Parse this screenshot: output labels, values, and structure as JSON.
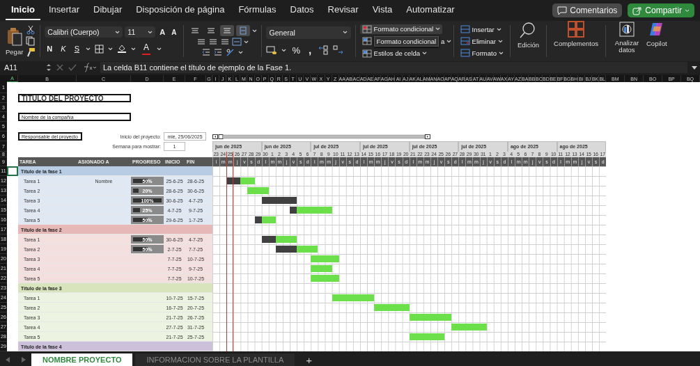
{
  "tabs": [
    {
      "label": "Inicio",
      "selected": true
    },
    {
      "label": "Insertar",
      "selected": false
    },
    {
      "label": "Dibujar",
      "selected": false
    },
    {
      "label": "Disposición de página",
      "selected": false
    },
    {
      "label": "Fórmulas",
      "selected": false
    },
    {
      "label": "Datos",
      "selected": false
    },
    {
      "label": "Revisar",
      "selected": false
    },
    {
      "label": "Vista",
      "selected": false
    },
    {
      "label": "Automatizar",
      "selected": false
    }
  ],
  "comments_button": "Comentarios",
  "share_button": "Compartir",
  "ribbon": {
    "paste": "Pegar",
    "font_family": "Calibri (Cuerpo)",
    "font_size": "11",
    "grow": "A",
    "shrink": "A",
    "bold": "N",
    "italic": "K",
    "underline": "S",
    "font_color": "A",
    "align_buttons": [
      {
        "on": false
      },
      {
        "on": false
      },
      {
        "on": true
      },
      {
        "on": true
      }
    ],
    "number_format": "General",
    "percent": "%",
    "comma": ",",
    "styles": [
      {
        "label": "Formato condicional",
        "highlighted": true
      },
      {
        "label": "a",
        "tooltip": "Formato condicional",
        "highlighted": false
      },
      {
        "label": "Estilos de celda",
        "highlighted": false
      }
    ],
    "cells": [
      "Insertar",
      "Eliminar",
      "Formato"
    ],
    "editing": "Edición",
    "addins": "Complementos",
    "analyze": "Analizar datos",
    "copilot": "Copilot"
  },
  "formula_bar": {
    "name_box": "A11",
    "formula": "La celda B11 contiene el título de ejemplo de la Fase 1."
  },
  "sheet": {
    "columns": [
      "A",
      "B",
      "C",
      "D",
      "E",
      "F",
      "G",
      "I",
      "J",
      "K",
      "L",
      "M",
      "N",
      "O",
      "P",
      "Q",
      "R",
      "S",
      "T",
      "U",
      "V",
      "W",
      "X",
      "Y",
      "Z",
      "AA",
      "AB",
      "AC",
      "AD",
      "AE",
      "AF",
      "AG",
      "AH",
      "AI",
      "AJ",
      "AK",
      "AL",
      "AM",
      "AN",
      "AO",
      "AP",
      "AQ",
      "AR",
      "AS",
      "AT",
      "AU",
      "AV",
      "AW",
      "AX",
      "AY",
      "AZ",
      "BA",
      "BB",
      "BC",
      "BD",
      "BE",
      "BF",
      "BG",
      "BH",
      "BI",
      "BJ",
      "BK",
      "BL",
      "BM",
      "BN",
      "BO",
      "BP",
      "BQ"
    ],
    "rows": [
      "1",
      "2",
      "3",
      "4",
      "5",
      "6",
      "7",
      "8",
      "9",
      "11",
      "12",
      "13",
      "14",
      "15",
      "16",
      "17",
      "18",
      "19",
      "20",
      "21",
      "22",
      "23",
      "24",
      "25",
      "26",
      "27",
      "28",
      "29"
    ],
    "title": "TÍTULO DEL PROYECTO",
    "company": "Nombre de la compañía",
    "manager": "Responsable del proyecto",
    "start_label": "Inicio del proyecto:",
    "start_value": "mié, 25/06/2025",
    "week_label": "Semana para mostrar:",
    "week_value": "1",
    "headers": [
      "TAREA",
      "ASIGNADO A",
      "PROGRESO",
      "INICIO",
      "FIN"
    ],
    "weeks": [
      {
        "label": "jun de 2025",
        "days": [
          {
            "num": "23",
            "weekday": "l",
            "today": false
          },
          {
            "num": "24",
            "weekday": "m",
            "today": false
          },
          {
            "num": "25",
            "weekday": "m",
            "today": true
          },
          {
            "num": "26",
            "weekday": "j",
            "today": false
          },
          {
            "num": "27",
            "weekday": "v",
            "today": false
          },
          {
            "num": "28",
            "weekday": "s",
            "today": false
          },
          {
            "num": "29",
            "weekday": "d",
            "today": false
          }
        ]
      },
      {
        "label": "jun de 2025",
        "days": [
          {
            "num": "30",
            "weekday": "l",
            "today": false
          },
          {
            "num": "1",
            "weekday": "m",
            "today": false
          },
          {
            "num": "2",
            "weekday": "m",
            "today": false
          },
          {
            "num": "3",
            "weekday": "j",
            "today": false
          },
          {
            "num": "4",
            "weekday": "v",
            "today": false
          },
          {
            "num": "5",
            "weekday": "s",
            "today": false
          },
          {
            "num": "6",
            "weekday": "d",
            "today": false
          }
        ]
      },
      {
        "label": "jul de 2025",
        "days": [
          {
            "num": "7",
            "weekday": "l",
            "today": false
          },
          {
            "num": "8",
            "weekday": "m",
            "today": false
          },
          {
            "num": "9",
            "weekday": "m",
            "today": false
          },
          {
            "num": "10",
            "weekday": "j",
            "today": false
          },
          {
            "num": "11",
            "weekday": "v",
            "today": false
          },
          {
            "num": "12",
            "weekday": "s",
            "today": false
          },
          {
            "num": "13",
            "weekday": "d",
            "today": false
          }
        ]
      },
      {
        "label": "jul de 2025",
        "days": [
          {
            "num": "14",
            "weekday": "l",
            "today": false
          },
          {
            "num": "15",
            "weekday": "m",
            "today": false
          },
          {
            "num": "16",
            "weekday": "m",
            "today": false
          },
          {
            "num": "17",
            "weekday": "j",
            "today": false
          },
          {
            "num": "18",
            "weekday": "v",
            "today": false
          },
          {
            "num": "19",
            "weekday": "s",
            "today": false
          },
          {
            "num": "20",
            "weekday": "d",
            "today": false
          }
        ]
      },
      {
        "label": "jul de 2025",
        "days": [
          {
            "num": "21",
            "weekday": "l",
            "today": false
          },
          {
            "num": "22",
            "weekday": "m",
            "today": false
          },
          {
            "num": "23",
            "weekday": "m",
            "today": false
          },
          {
            "num": "24",
            "weekday": "j",
            "today": false
          },
          {
            "num": "25",
            "weekday": "v",
            "today": false
          },
          {
            "num": "26",
            "weekday": "s",
            "today": false
          },
          {
            "num": "27",
            "weekday": "d",
            "today": false
          }
        ]
      },
      {
        "label": "jul de 2025",
        "days": [
          {
            "num": "28",
            "weekday": "l",
            "today": false
          },
          {
            "num": "29",
            "weekday": "m",
            "today": false
          },
          {
            "num": "30",
            "weekday": "m",
            "today": false
          },
          {
            "num": "31",
            "weekday": "j",
            "today": false
          },
          {
            "num": "1",
            "weekday": "v",
            "today": false
          },
          {
            "num": "2",
            "weekday": "s",
            "today": false
          },
          {
            "num": "3",
            "weekday": "d",
            "today": false
          }
        ]
      },
      {
        "label": "ago de 2025",
        "days": [
          {
            "num": "4",
            "weekday": "l",
            "today": false
          },
          {
            "num": "5",
            "weekday": "m",
            "today": false
          },
          {
            "num": "6",
            "weekday": "m",
            "today": false
          },
          {
            "num": "7",
            "weekday": "j",
            "today": false
          },
          {
            "num": "8",
            "weekday": "v",
            "today": false
          },
          {
            "num": "9",
            "weekday": "s",
            "today": false
          },
          {
            "num": "10",
            "weekday": "d",
            "today": false
          }
        ]
      },
      {
        "label": "ago de 2025",
        "days": [
          {
            "num": "11",
            "weekday": "l",
            "today": false
          },
          {
            "num": "12",
            "weekday": "m",
            "today": false
          },
          {
            "num": "13",
            "weekday": "m",
            "today": false
          },
          {
            "num": "14",
            "weekday": "j",
            "today": false
          },
          {
            "num": "15",
            "weekday": "v",
            "today": false
          },
          {
            "num": "16",
            "weekday": "s",
            "today": false
          },
          {
            "num": "17",
            "weekday": "d",
            "today": false
          }
        ]
      }
    ],
    "phases": [
      {
        "title": "Título de la fase 1",
        "color": "#b8cce4",
        "tasks": [
          {
            "name": "Tarea 1",
            "assignee": "Nombre",
            "progress": "50%",
            "level": 0.5,
            "start": "25-6-25",
            "end": "28-6-25"
          },
          {
            "name": "Tarea 2",
            "progress": "20%",
            "level": 0.2,
            "start": "28-6-25",
            "end": "30-6-25"
          },
          {
            "name": "Tarea 3",
            "progress": "100%",
            "level": 1,
            "start": "30-6-25",
            "end": "4-7-25"
          },
          {
            "name": "Tarea 4",
            "progress": "25%",
            "level": 0.25,
            "start": "4-7-25",
            "end": "9-7-25"
          },
          {
            "name": "Tarea 5",
            "progress": "50%",
            "level": 0.5,
            "start": "29-6-25",
            "end": "1-7-25"
          }
        ]
      },
      {
        "title": "Título de la fase 2",
        "color": "#e6b8b7",
        "tasks": [
          {
            "name": "Tarea 1",
            "progress": "50%",
            "level": 0.5,
            "start": "30-6-25",
            "end": "4-7-25"
          },
          {
            "name": "Tarea 2",
            "progress": "50%",
            "level": 0.5,
            "start": "2-7-25",
            "end": "7-7-25"
          },
          {
            "name": "Tarea 3",
            "start": "7-7-25",
            "end": "10-7-25"
          },
          {
            "name": "Tarea 4",
            "start": "7-7-25",
            "end": "9-7-25"
          },
          {
            "name": "Tarea 5",
            "start": "7-7-25",
            "end": "10-7-25"
          }
        ]
      },
      {
        "title": "Título de la fase 3",
        "color": "#d8e4bc",
        "tasks": [
          {
            "name": "Tarea 1",
            "start": "10-7-25",
            "end": "15-7-25"
          },
          {
            "name": "Tarea 2",
            "start": "16-7-25",
            "end": "20-7-25"
          },
          {
            "name": "Tarea 3",
            "start": "21-7-25",
            "end": "26-7-25"
          },
          {
            "name": "Tarea 4",
            "start": "27-7-25",
            "end": "31-7-25"
          },
          {
            "name": "Tarea 5",
            "start": "21-7-25",
            "end": "25-7-25"
          }
        ]
      },
      {
        "title": "Título de la fase 4",
        "color": "#ccc0da"
      }
    ]
  },
  "sheet_tabs": [
    {
      "label": "NOMBRE PROYECTO",
      "selected": true
    },
    {
      "label": "INFORMACION SOBRE LA PLANTILLA",
      "selected": false
    }
  ],
  "add_sheet": "+"
}
